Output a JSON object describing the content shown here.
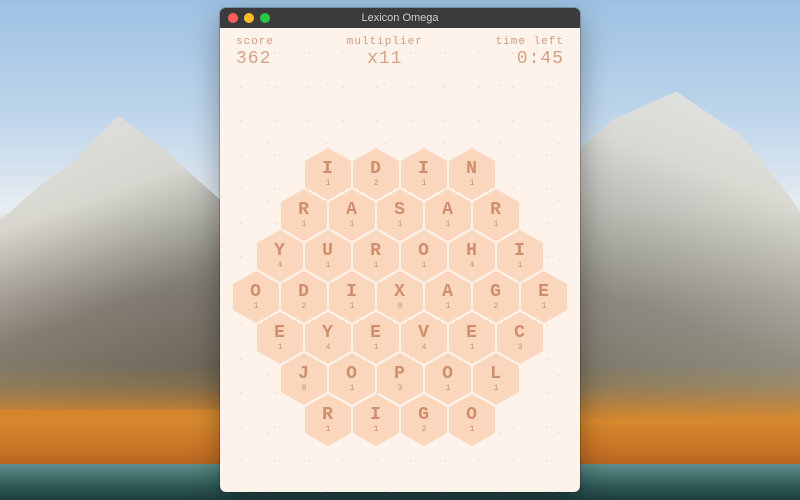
{
  "window": {
    "title": "Lexicon Omega"
  },
  "hud": {
    "score_label": "score",
    "score_value": "362",
    "multiplier_label": "multiplier",
    "multiplier_value": "x11",
    "time_label": "time left",
    "time_value": "0:45"
  },
  "colors": {
    "game_bg": "#fef3ea",
    "tile_bg": "#fad6bd",
    "text": "#cf8e6d"
  },
  "board": {
    "rows": [
      [
        {
          "letter": "I",
          "pts": "1"
        },
        {
          "letter": "D",
          "pts": "2"
        },
        {
          "letter": "I",
          "pts": "1"
        },
        {
          "letter": "N",
          "pts": "1"
        }
      ],
      [
        {
          "letter": "R",
          "pts": "1"
        },
        {
          "letter": "A",
          "pts": "1"
        },
        {
          "letter": "S",
          "pts": "1"
        },
        {
          "letter": "A",
          "pts": "1"
        },
        {
          "letter": "R",
          "pts": "1"
        }
      ],
      [
        {
          "letter": "Y",
          "pts": "4"
        },
        {
          "letter": "U",
          "pts": "1"
        },
        {
          "letter": "R",
          "pts": "1"
        },
        {
          "letter": "O",
          "pts": "1"
        },
        {
          "letter": "H",
          "pts": "4"
        },
        {
          "letter": "I",
          "pts": "1"
        }
      ],
      [
        {
          "letter": "O",
          "pts": "1"
        },
        {
          "letter": "D",
          "pts": "2"
        },
        {
          "letter": "I",
          "pts": "1"
        },
        {
          "letter": "X",
          "pts": "8"
        },
        {
          "letter": "A",
          "pts": "1"
        },
        {
          "letter": "G",
          "pts": "2"
        },
        {
          "letter": "E",
          "pts": "1"
        }
      ],
      [
        {
          "letter": "E",
          "pts": "1"
        },
        {
          "letter": "Y",
          "pts": "4"
        },
        {
          "letter": "E",
          "pts": "1"
        },
        {
          "letter": "V",
          "pts": "4"
        },
        {
          "letter": "E",
          "pts": "1"
        },
        {
          "letter": "C",
          "pts": "3"
        }
      ],
      [
        {
          "letter": "J",
          "pts": "8"
        },
        {
          "letter": "O",
          "pts": "1"
        },
        {
          "letter": "P",
          "pts": "3"
        },
        {
          "letter": "O",
          "pts": "1"
        },
        {
          "letter": "L",
          "pts": "1"
        }
      ],
      [
        {
          "letter": "R",
          "pts": "1"
        },
        {
          "letter": "I",
          "pts": "1"
        },
        {
          "letter": "G",
          "pts": "2"
        },
        {
          "letter": "O",
          "pts": "1"
        }
      ]
    ]
  }
}
